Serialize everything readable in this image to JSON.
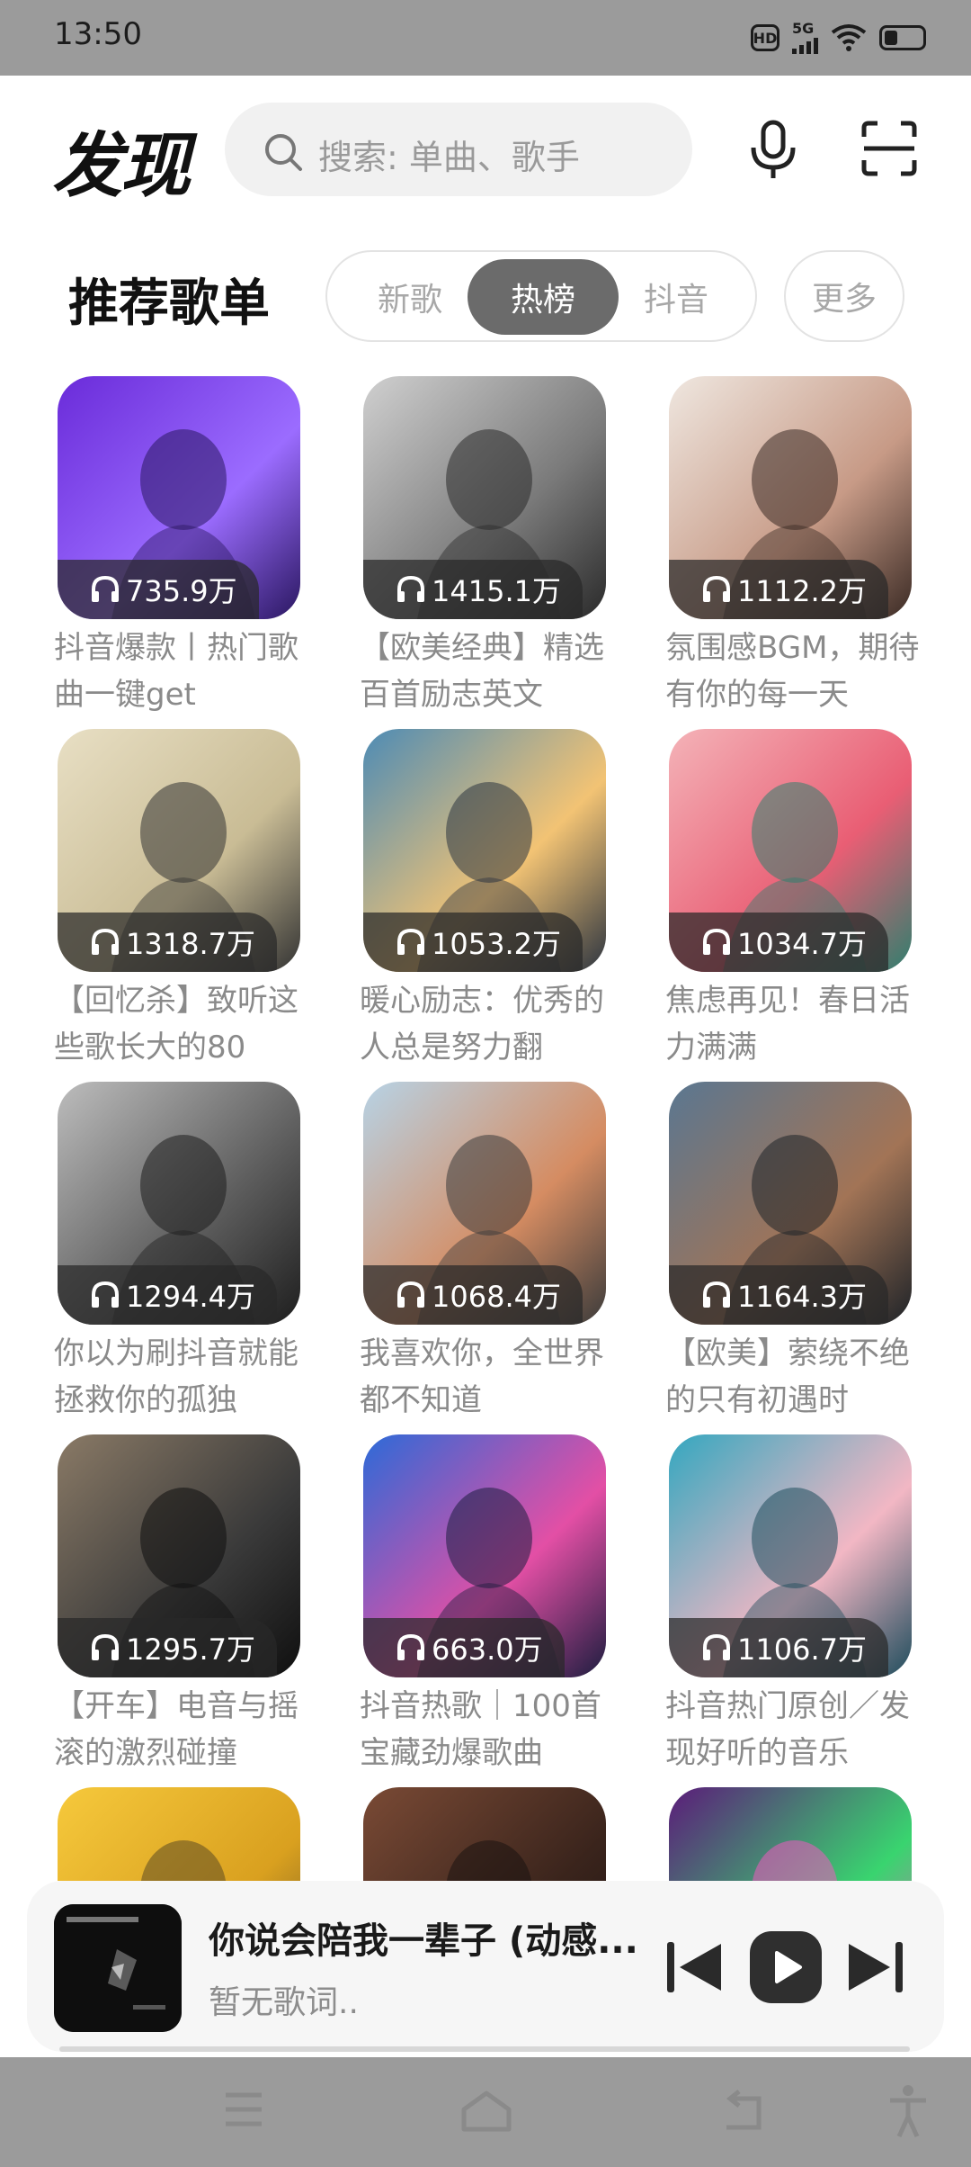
{
  "status_bar": {
    "time": "13:50",
    "hd_badge": "HD",
    "network_label": "5G",
    "icons": [
      "hd-icon",
      "signal-icon",
      "wifi-icon",
      "battery-icon"
    ]
  },
  "header": {
    "title": "发现",
    "search_placeholder": "搜索: 单曲、歌手",
    "icons": [
      "search-icon",
      "mic-icon",
      "scan-icon"
    ]
  },
  "section": {
    "title": "推荐歌单",
    "tabs": [
      {
        "label": "新歌",
        "active": false
      },
      {
        "label": "热榜",
        "active": true
      },
      {
        "label": "抖音",
        "active": false
      }
    ],
    "more_label": "更多"
  },
  "playlists": [
    {
      "count": "735.9万",
      "title": "抖音爆款丨热门歌曲一键get"
    },
    {
      "count": "1415.1万",
      "title": "【欧美经典】精选百首励志英文"
    },
    {
      "count": "1112.2万",
      "title": "氛围感BGM，期待有你的每一天"
    },
    {
      "count": "1318.7万",
      "title": "【回忆杀】致听这些歌长大的80"
    },
    {
      "count": "1053.2万",
      "title": "暖心励志：优秀的人总是努力翻"
    },
    {
      "count": "1034.7万",
      "title": "焦虑再见！春日活力满满"
    },
    {
      "count": "1294.4万",
      "title": "你以为刷抖音就能拯救你的孤独"
    },
    {
      "count": "1068.4万",
      "title": "我喜欢你，全世界都不知道"
    },
    {
      "count": "1164.3万",
      "title": "【欧美】萦绕不绝的只有初遇时"
    },
    {
      "count": "1295.7万",
      "title": "【开车】电音与摇滚的激烈碰撞"
    },
    {
      "count": "663.0万",
      "title": "抖音热歌｜100首宝藏劲爆歌曲"
    },
    {
      "count": "1106.7万",
      "title": "抖音热门原创／发现好听的音乐"
    }
  ],
  "cover_art": [
    {
      "name": "purple-girl-headphones",
      "colors": [
        "#6a2bd9",
        "#9b6cff",
        "#2a1760"
      ]
    },
    {
      "name": "bw-woman-brick-wall",
      "colors": [
        "#d0d0d0",
        "#7a7a7a",
        "#2a2a2a"
      ]
    },
    {
      "name": "girl-portrait-close",
      "colors": [
        "#efe7e0",
        "#c79a86",
        "#3a2a24"
      ]
    },
    {
      "name": "bicycle-cartoon",
      "colors": [
        "#e8dfc4",
        "#c9bc95",
        "#333333"
      ]
    },
    {
      "name": "sky-clouds-figure",
      "colors": [
        "#4d8bb5",
        "#f2c374",
        "#2c3440"
      ]
    },
    {
      "name": "pink-relax-illustration",
      "colors": [
        "#f4b3b8",
        "#e95e74",
        "#2f7f6e"
      ]
    },
    {
      "name": "bw-kids-phones",
      "colors": [
        "#bdbdbd",
        "#5c5c5c",
        "#1e1e1e"
      ]
    },
    {
      "name": "cartoon-couple-kiss",
      "colors": [
        "#b7d3e6",
        "#d58c62",
        "#3b3b3b"
      ]
    },
    {
      "name": "woman-windswept-hair",
      "colors": [
        "#5a7791",
        "#a27456",
        "#1e2328"
      ]
    },
    {
      "name": "black-sports-car",
      "colors": [
        "#8a7a66",
        "#3a3a3a",
        "#0f0f0f"
      ]
    },
    {
      "name": "neon-anime-girl",
      "colors": [
        "#2c6ad8",
        "#e34fa5",
        "#1c1d3f"
      ]
    },
    {
      "name": "teal-anime-boy",
      "colors": [
        "#33a7bf",
        "#f2b7c4",
        "#1d4c5c"
      ]
    },
    {
      "name": "yellow-partial",
      "colors": [
        "#f6c93c",
        "#d9a01f",
        "#5d4b23"
      ]
    },
    {
      "name": "dark-portrait-partial",
      "colors": [
        "#7a4a35",
        "#3a241c",
        "#1a1210"
      ]
    },
    {
      "name": "neon-stage-partial",
      "colors": [
        "#5b1b7a",
        "#39d46f",
        "#f05abf"
      ]
    }
  ],
  "player": {
    "title": "你说会陪我一辈子 (动感...",
    "subtitle": "暂无歌词..",
    "icons": [
      "prev-icon",
      "play-icon",
      "next-icon"
    ]
  },
  "nav": {
    "icons": [
      "menu-icon",
      "home-icon",
      "back-icon",
      "accessibility-icon"
    ]
  },
  "colors": {
    "system_bar": "#9b9b9b",
    "active_tab": "#6b6b6b",
    "muted_text": "#8a8a8a",
    "search_bg": "#f1f1f1"
  }
}
